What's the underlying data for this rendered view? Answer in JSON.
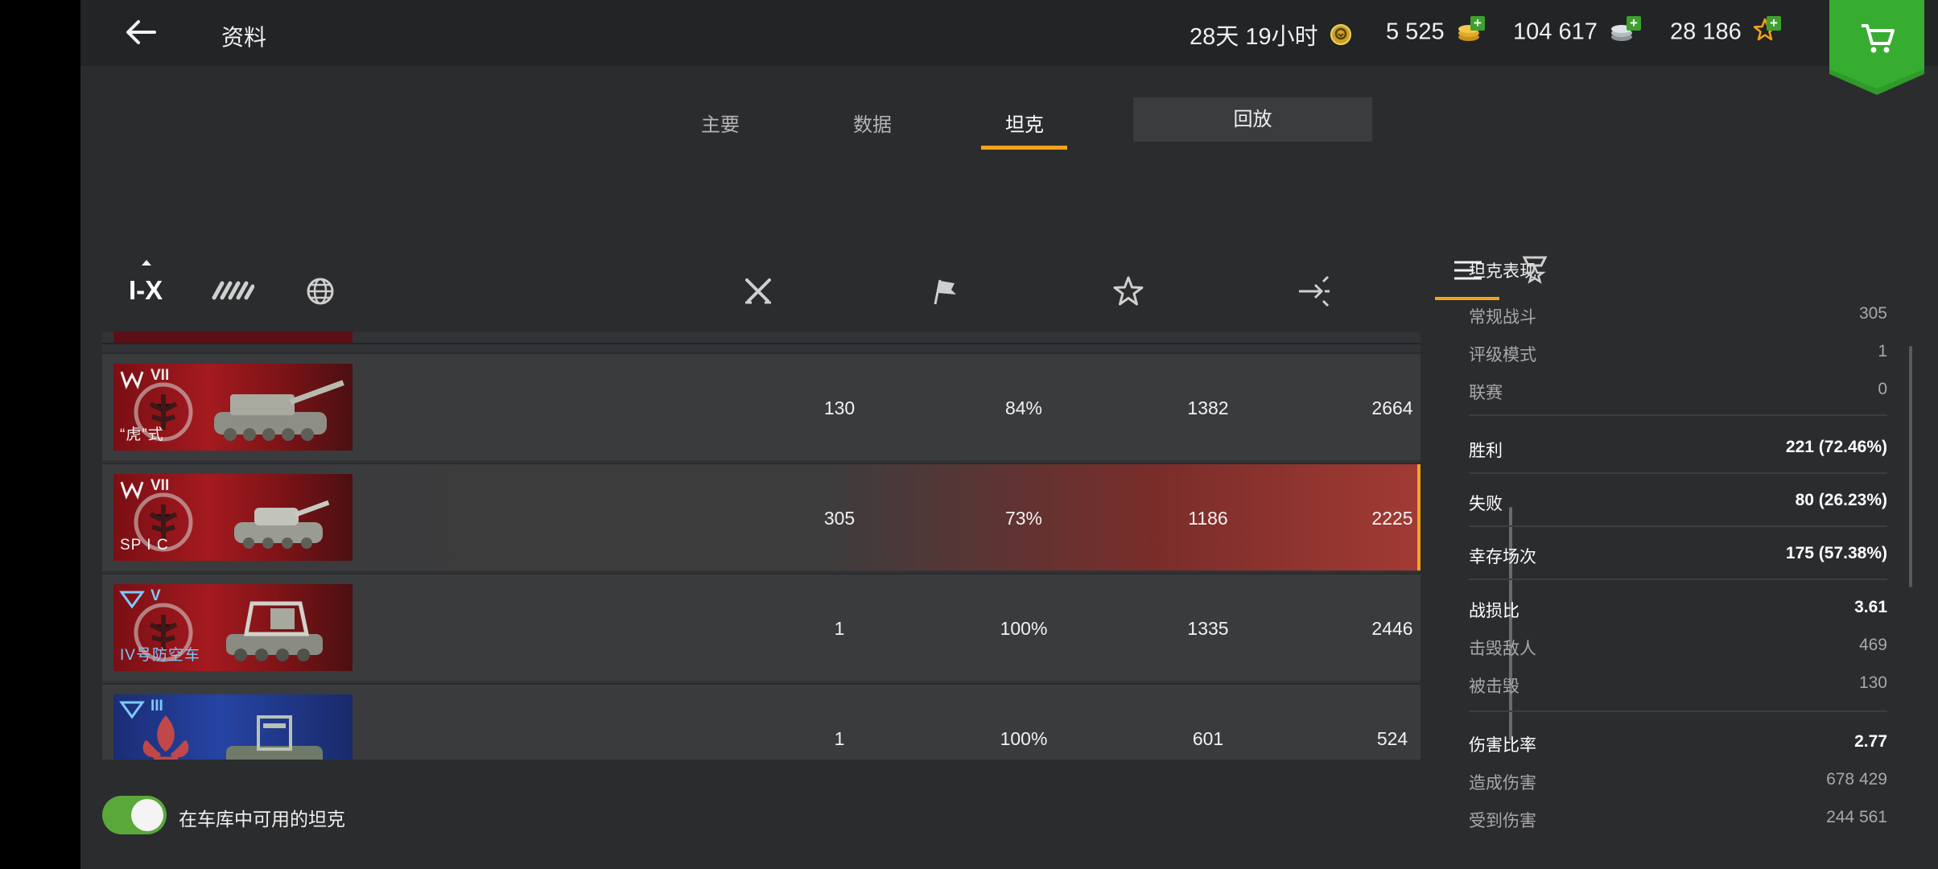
{
  "header": {
    "title": "资料",
    "premium_time": "28天 19小时",
    "gold": "5 525",
    "credits": "104 617",
    "free_xp": "28 186"
  },
  "tabs": [
    {
      "label": "主要"
    },
    {
      "label": "数据"
    },
    {
      "label": "坦克"
    },
    {
      "label": "回放"
    }
  ],
  "filters": {
    "tier_label": "I-X"
  },
  "tanks": [
    {
      "tier": "VII",
      "name": "“虎”式",
      "battles": "130",
      "win_rate": "84%",
      "avg_exp": "1382",
      "avg_damage": "2664",
      "flag": "red"
    },
    {
      "tier": "VII",
      "name": "SP I C",
      "battles": "305",
      "win_rate": "73%",
      "avg_exp": "1186",
      "avg_damage": "2225",
      "flag": "red"
    },
    {
      "tier": "V",
      "name": "IV号防空车",
      "battles": "1",
      "win_rate": "100%",
      "avg_exp": "1335",
      "avg_damage": "2446",
      "flag": "red"
    },
    {
      "tier": "III",
      "name": "",
      "battles": "1",
      "win_rate": "100%",
      "avg_exp": "601",
      "avg_damage": "524",
      "flag": "blue"
    }
  ],
  "toggle": {
    "label": "在车库中可用的坦克",
    "on": true
  },
  "panel": {
    "title": "坦克表现",
    "stats": [
      {
        "label": "常规战斗",
        "value": "305"
      },
      {
        "label": "评级模式",
        "value": "1"
      },
      {
        "label": "联赛",
        "value": "0"
      },
      {
        "label": "胜利",
        "value": "221 (72.46%)"
      },
      {
        "label": "失败",
        "value": "80 (26.23%)"
      },
      {
        "label": "幸存场次",
        "value": "175 (57.38%)"
      },
      {
        "label": "战损比",
        "value": "3.61"
      },
      {
        "label": "击毁敌人",
        "value": "469"
      },
      {
        "label": "被击毁",
        "value": "130"
      },
      {
        "label": "伤害比率",
        "value": "2.77"
      },
      {
        "label": "造成伤害",
        "value": "678 429"
      },
      {
        "label": "受到伤害",
        "value": "244 561"
      }
    ]
  },
  "colors": {
    "accent": "#f5a31a",
    "toggle_on": "#5aa83a",
    "shop": "#2e9a2a",
    "background": "#2b2c2e"
  }
}
